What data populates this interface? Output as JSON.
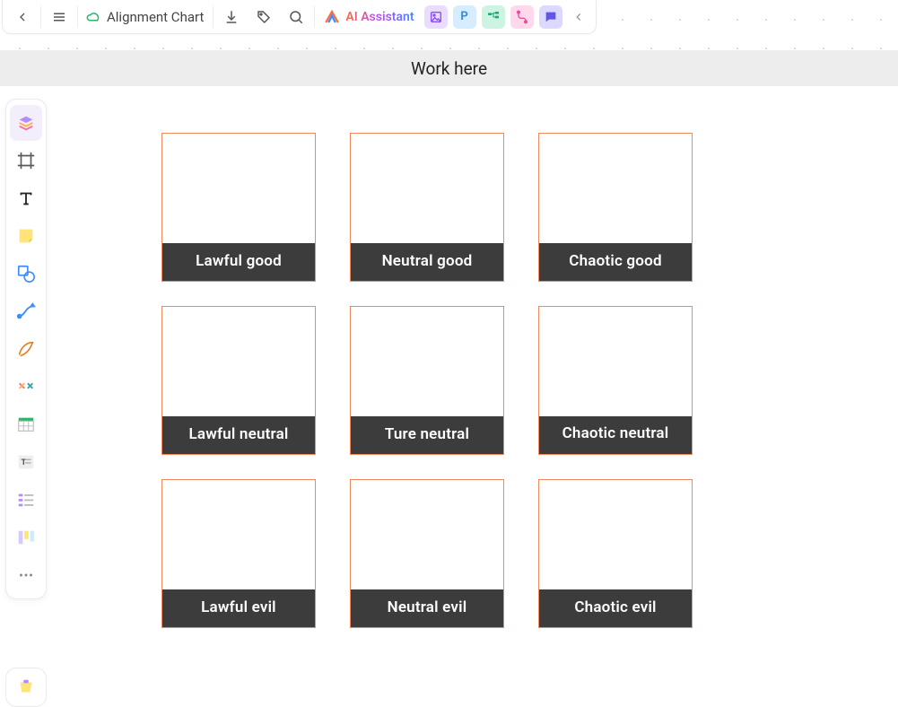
{
  "topbar": {
    "doc_title": "Alignment Chart",
    "ai_label": "AI Assistant"
  },
  "work_header": "Work here",
  "cells": [
    "Lawful good",
    "Neutral good",
    "Chaotic good",
    "Lawful neutral",
    "Ture neutral",
    "Chaotic neutral",
    "Lawful evil",
    "Neutral evil",
    "Chaotic evil"
  ]
}
